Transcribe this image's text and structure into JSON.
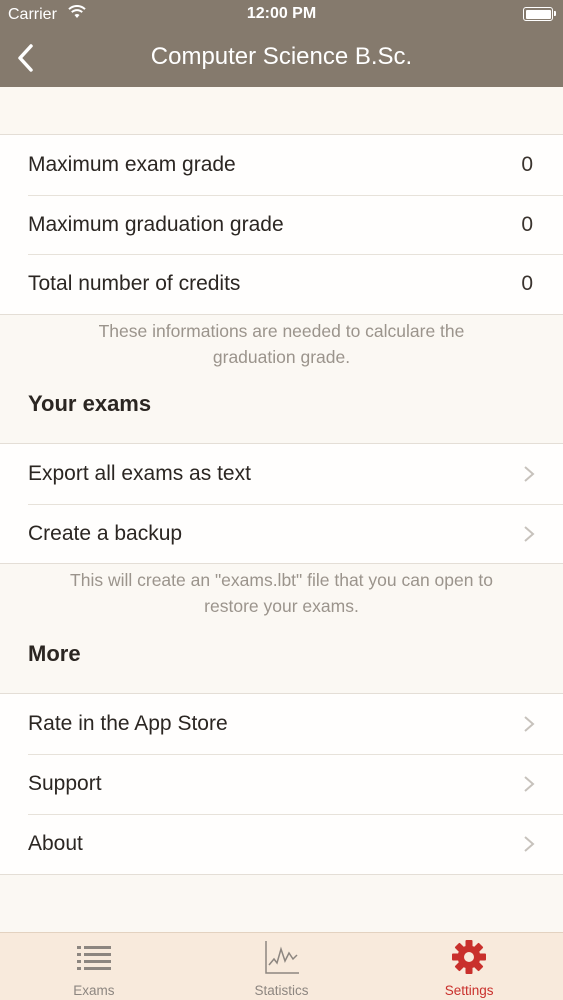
{
  "status_bar": {
    "carrier": "Carrier",
    "time": "12:00 PM"
  },
  "nav_bar": {
    "title": "Computer Science B.Sc."
  },
  "grading": {
    "rows": [
      {
        "label": "Maximum exam grade",
        "value": "0"
      },
      {
        "label": "Maximum graduation grade",
        "value": "0"
      },
      {
        "label": "Total number of credits",
        "value": "0"
      }
    ],
    "footer": "These informations are needed to calculare the graduation grade."
  },
  "exams_section": {
    "header": "Your exams",
    "rows": [
      {
        "label": "Export all exams as text"
      },
      {
        "label": "Create a backup"
      }
    ],
    "footer": "This will create an \"exams.lbt\" file that you can open to restore your exams."
  },
  "more_section": {
    "header": "More",
    "rows": [
      {
        "label": "Rate in the App Store"
      },
      {
        "label": "Support"
      },
      {
        "label": "About"
      }
    ]
  },
  "tab_bar": {
    "tabs": [
      {
        "label": "Exams",
        "icon": "list-icon"
      },
      {
        "label": "Statistics",
        "icon": "chart-icon"
      },
      {
        "label": "Settings",
        "icon": "gear-icon",
        "active": true
      }
    ]
  },
  "colors": {
    "nav_background": "#857a6d",
    "active_tab": "#c9302c",
    "inactive_tab": "#8d8680",
    "page_background": "#fbf8f3"
  }
}
